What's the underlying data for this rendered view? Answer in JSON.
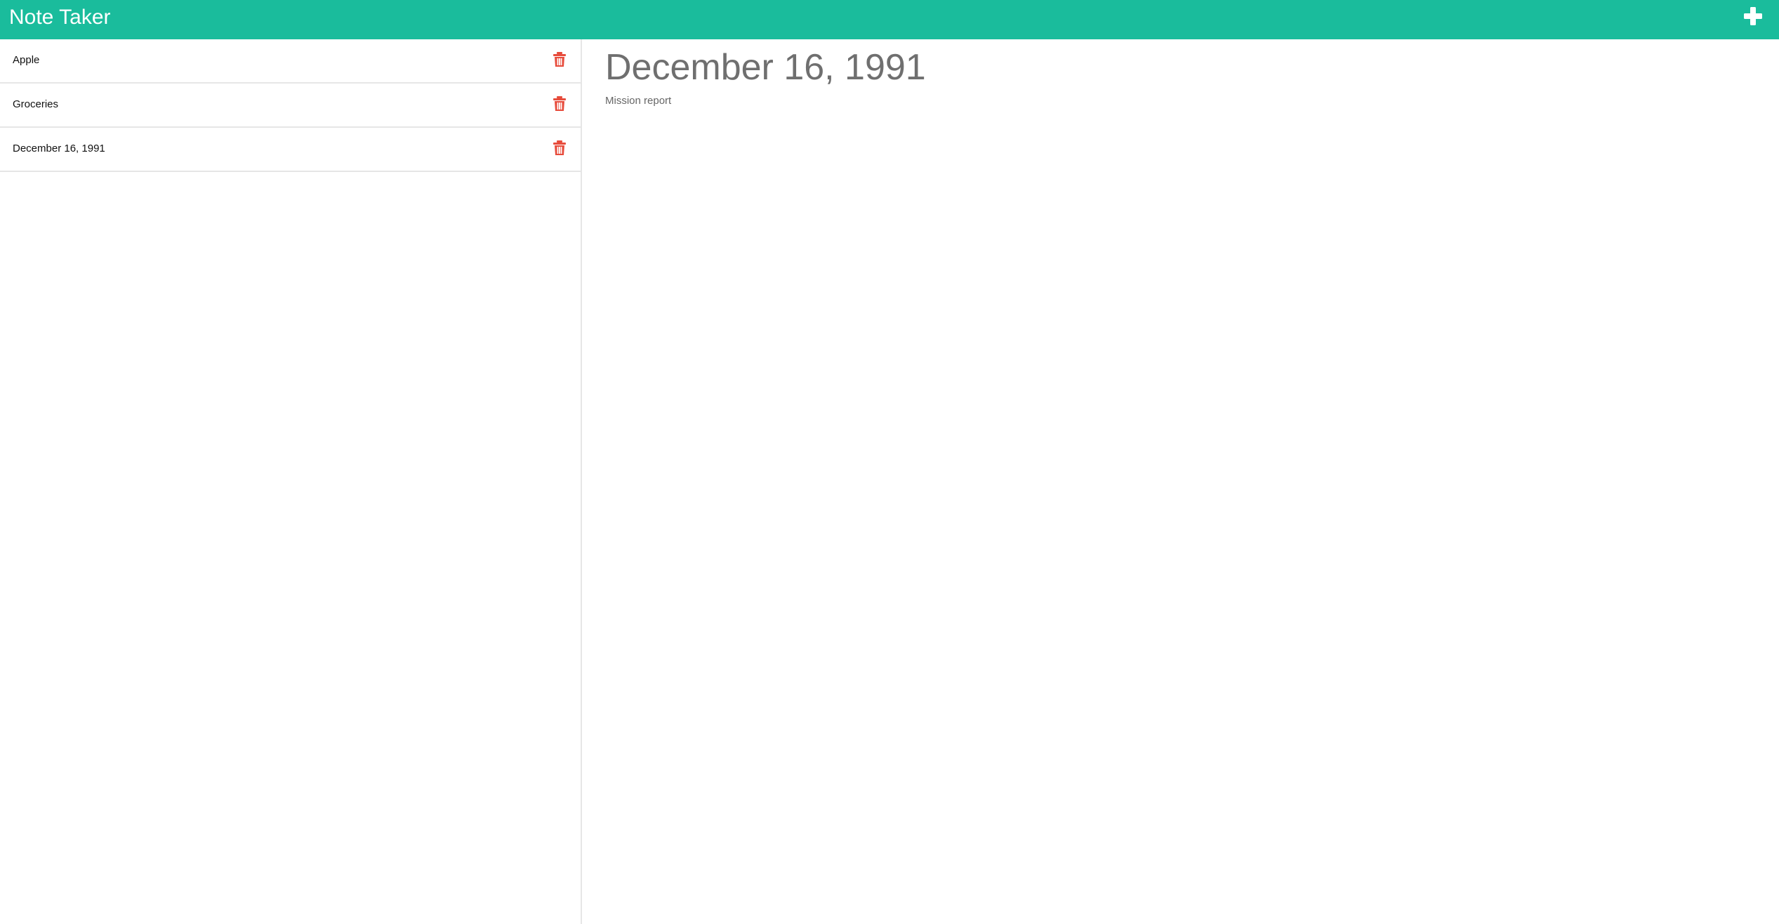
{
  "app": {
    "title": "Note Taker"
  },
  "colors": {
    "navbar": "#1abc9c",
    "trash": "#e74c3c",
    "title_text": "#6f6f6f"
  },
  "icons": {
    "add": "plus-icon",
    "delete": "trash-icon"
  },
  "notes": [
    {
      "title": "Apple"
    },
    {
      "title": "Groceries"
    },
    {
      "title": "December 16, 1991"
    }
  ],
  "active_note": {
    "title": "December 16, 1991",
    "text": "Mission report"
  }
}
